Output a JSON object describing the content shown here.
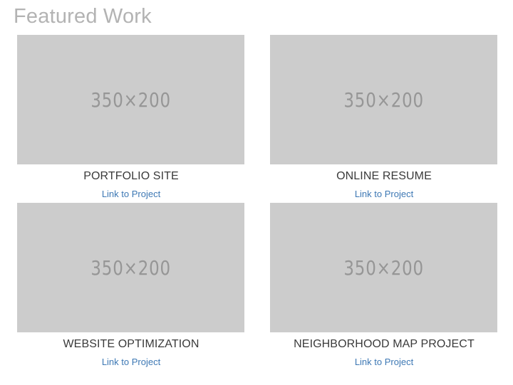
{
  "section": {
    "title": "Featured Work"
  },
  "colors": {
    "title": "#b3b3b3",
    "placeholder_bg": "#cccccc",
    "placeholder_text": "#969696",
    "card_title": "#3a3a3a",
    "link": "#3d78b4"
  },
  "projects": [
    {
      "thumbnail_text": "350×200",
      "title": "PORTFOLIO SITE",
      "link_label": "Link to Project"
    },
    {
      "thumbnail_text": "350×200",
      "title": "ONLINE RESUME",
      "link_label": "Link to Project"
    },
    {
      "thumbnail_text": "350×200",
      "title": "WEBSITE OPTIMIZATION",
      "link_label": "Link to Project"
    },
    {
      "thumbnail_text": "350×200",
      "title": "NEIGHBORHOOD MAP PROJECT",
      "link_label": "Link to Project"
    }
  ]
}
